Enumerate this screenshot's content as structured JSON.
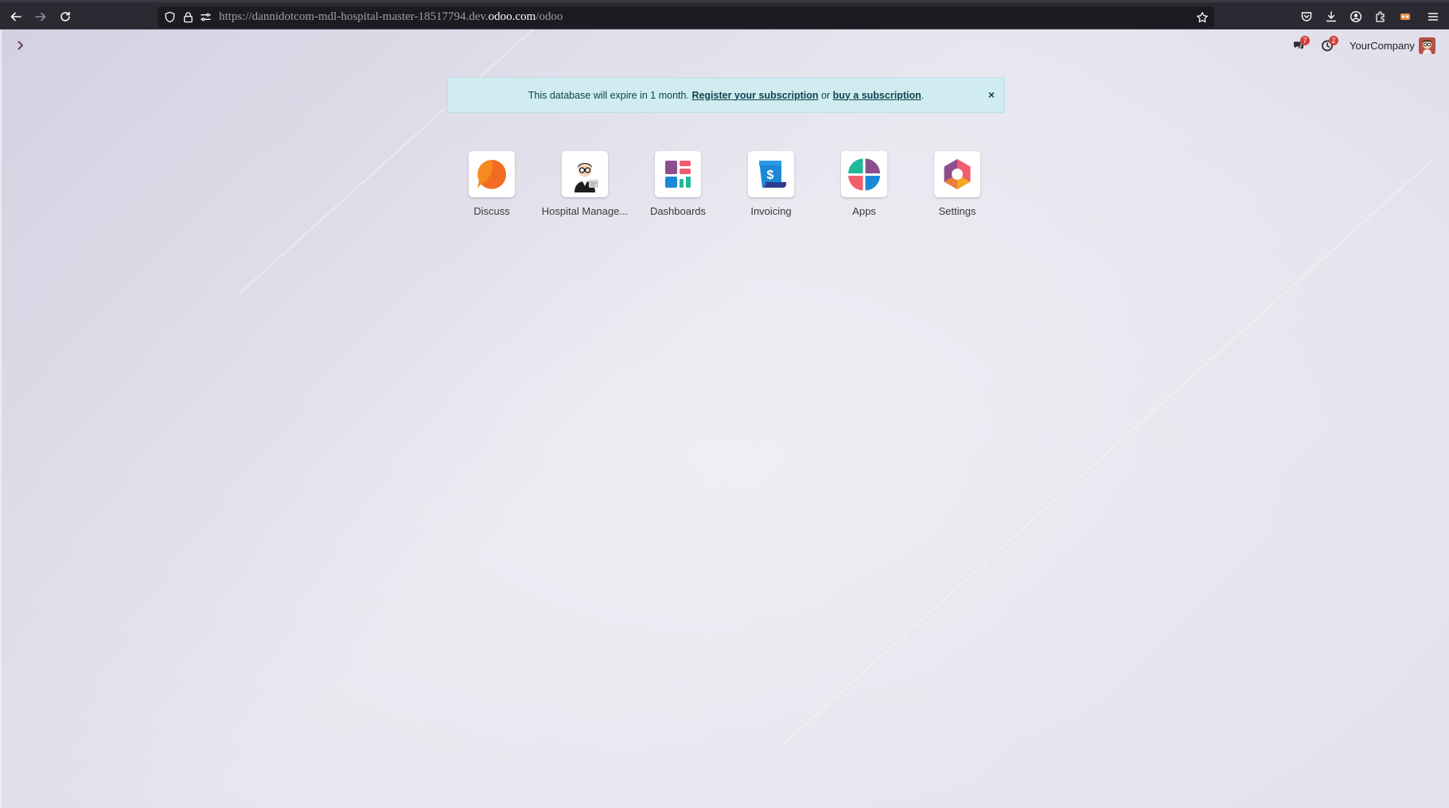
{
  "browser": {
    "url_prefix": "https://dannidotcom-mdl-hospital-master-18517794.dev.",
    "url_host": "odoo.com",
    "url_suffix": "/odoo"
  },
  "systray": {
    "messages_count": "7",
    "activities_count": "2",
    "company": "YourCompany"
  },
  "alert": {
    "text": "This database will expire in 1 month.",
    "register_link": "Register your subscription",
    "or_text": "or",
    "buy_link": "buy a subscription",
    "period": ".",
    "close": "×"
  },
  "apps": [
    {
      "label": "Discuss",
      "icon": "discuss-icon",
      "color": "#f58b1f"
    },
    {
      "label": "Hospital Manage...",
      "icon": "hospital-icon",
      "color": "#1e1e1e"
    },
    {
      "label": "Dashboards",
      "icon": "dashboards-icon",
      "color": "#8b4f8e"
    },
    {
      "label": "Invoicing",
      "icon": "invoicing-icon",
      "color": "#1a88d6"
    },
    {
      "label": "Apps",
      "icon": "apps-icon",
      "color": "#f05d6c"
    },
    {
      "label": "Settings",
      "icon": "settings-icon",
      "color": "#8b4f8e"
    }
  ],
  "colors": {
    "alert_bg": "#d0ecf1",
    "alert_text": "#0e434e",
    "badge": "#d23f3a",
    "browser_bar": "#2b2a33"
  }
}
